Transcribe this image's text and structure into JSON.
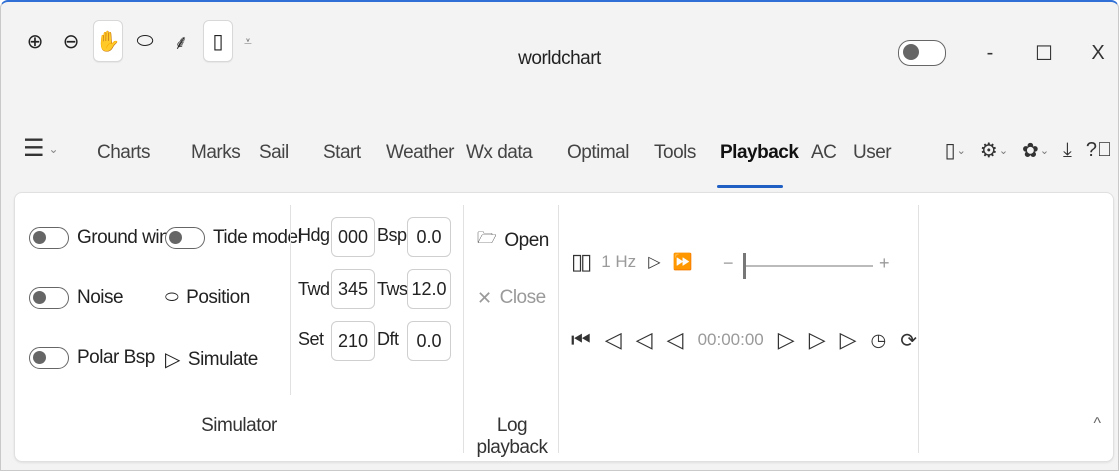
{
  "window": {
    "title": "worldchart"
  },
  "toolbar": {
    "tools": [
      {
        "name": "zoom-in-icon",
        "glyph": "⊕"
      },
      {
        "name": "zoom-out-icon",
        "glyph": "⊖"
      },
      {
        "name": "pan-hand-icon",
        "glyph": "✋"
      },
      {
        "name": "boat-icon",
        "glyph": "⬭"
      },
      {
        "name": "route-icon",
        "glyph": "ℵ"
      },
      {
        "name": "phone-device-icon",
        "glyph": "▯"
      },
      {
        "name": "qat-dropdown-icon",
        "glyph": "⩡"
      }
    ]
  },
  "window_controls": {
    "minimize": "-",
    "maximize": "☐",
    "close": "X"
  },
  "menu": {
    "tabs": [
      "Charts",
      "Marks",
      "Sail",
      "Start",
      "Weather",
      "Wx data",
      "Optimal",
      "Tools",
      "Playback",
      "AC",
      "User"
    ],
    "active": "Playback"
  },
  "simulator": {
    "ground_wind": "Ground wind",
    "tide_model": "Tide model",
    "noise": "Noise",
    "position": "Position",
    "polar_bsp": "Polar Bsp",
    "simulate": "Simulate",
    "label": "Simulator",
    "hdg_label": "Hdg",
    "hdg": "000",
    "bsp_label": "Bsp",
    "bsp": "0.0",
    "twd_label": "Twd",
    "twd": "345",
    "tws_label": "Tws",
    "tws": "12.0",
    "set_label": "Set",
    "set": "210",
    "dft_label": "Dft",
    "dft": "0.0"
  },
  "log_playback": {
    "open": "Open",
    "close": "Close",
    "label": "Log playback"
  },
  "playback": {
    "rate": "1 Hz",
    "time": "00:00:00",
    "slider_plus": "+",
    "slider_minus": "−"
  },
  "collapse_ribbon": "^"
}
